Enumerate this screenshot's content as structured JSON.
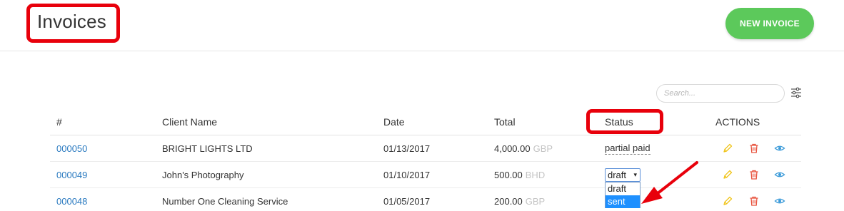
{
  "header": {
    "title": "Invoices",
    "new_invoice_label": "NEW INVOICE"
  },
  "search": {
    "placeholder": "Search...",
    "value": ""
  },
  "table": {
    "columns": [
      "#",
      "Client Name",
      "Date",
      "Total",
      "Status",
      "ACTIONS"
    ],
    "rows": [
      {
        "number": "000050",
        "client": "BRIGHT LIGHTS LTD",
        "date": "01/13/2017",
        "amount": "4,000.00",
        "currency": "GBP",
        "status": "partial paid"
      },
      {
        "number": "000049",
        "client": "John's Photography",
        "date": "01/10/2017",
        "amount": "500.00",
        "currency": "BHD",
        "status": "draft"
      },
      {
        "number": "000048",
        "client": "Number One Cleaning Service",
        "date": "01/05/2017",
        "amount": "200.00",
        "currency": "GBP",
        "status": ""
      }
    ]
  },
  "status_dropdown": {
    "selected": "draft",
    "caret": "▾",
    "options": [
      "draft",
      "sent"
    ],
    "highlighted": "sent"
  },
  "colors": {
    "accent_green": "#5cc95b",
    "link_blue": "#2a7ac0",
    "highlight_red": "#e8000b",
    "edit_icon": "#f0c419",
    "delete_icon": "#e8543f",
    "view_icon": "#3a9ad9"
  },
  "icons": [
    "filter-icon",
    "edit-icon",
    "delete-icon",
    "view-icon",
    "arrow-annotation"
  ]
}
